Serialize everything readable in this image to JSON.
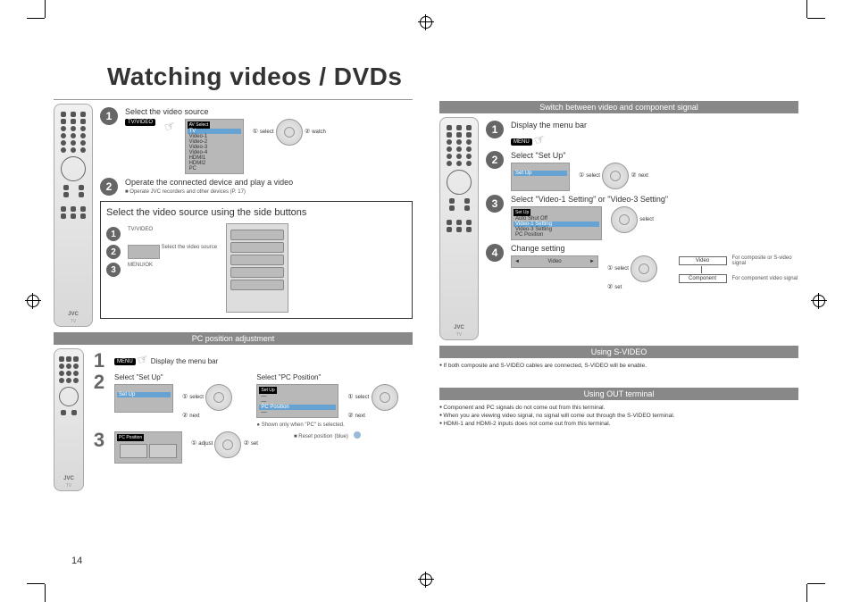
{
  "title": "Watching videos / DVDs",
  "page_number": "14",
  "remote": {
    "brand": "JVC",
    "model_label": "TV"
  },
  "left": {
    "step1": {
      "title": "Select the video source",
      "av_select_label": "AV Select",
      "sources": [
        "TV",
        "Video-1",
        "Video-2",
        "Video-3",
        "Video-4",
        "HDMI1",
        "HDMI2",
        "PC"
      ],
      "dial_top": "select",
      "dial_bottom": "watch",
      "key_label": "TV/VIDEO"
    },
    "step2": {
      "title": "Operate the connected device and play a video",
      "note": "Operate JVC recorders and other devices (P. 17)"
    },
    "boxed": {
      "title": "Select the video source using the side buttons",
      "s1": "TV/VIDEO",
      "s2": "Select the video source",
      "s3": "MENU/OK"
    },
    "pc_section": {
      "bar": "PC position adjustment",
      "s1_title": "Display the menu bar",
      "menu_key": "MENU",
      "s2_titleA": "Select \"Set Up\"",
      "s2_titleB": "Select \"PC Position\"",
      "menuA_header": "Set Up",
      "menuA_item": "Set Up",
      "menuB_header": "Set Up",
      "menuB_note": "Shown only when \"PC\" is selected.",
      "dial_sel": "select",
      "dial_next": "next",
      "s3_header": "PC Position",
      "s3_adjust": "adjust",
      "s3_set": "set",
      "reset_label": "Reset position",
      "blue_label": "(blue)"
    }
  },
  "right": {
    "switch_bar": "Switch between video and component signal",
    "s1_title": "Display the menu bar",
    "menu_key": "MENU",
    "s2_title": "Select \"Set Up\"",
    "menu2_item": "Set Up",
    "dial_sel": "select",
    "dial_next": "next",
    "s3_title": "Select \"Video-1 Setting\" or \"Video-3 Setting\"",
    "menu3_header": "Set Up",
    "menu3_rows": [
      "Auto Shut Off",
      "Video-1 Setting",
      "Video-3 Setting",
      "PC Position"
    ],
    "s3_dial": "select",
    "s4_title": "Change setting",
    "s4_row_label": "Video",
    "s4_dial_top": "select",
    "s4_dial_bottom": "set",
    "legend": {
      "video": "Video",
      "video_note": "For composite or S-video signal",
      "component": "Component",
      "component_note": "For component video signal"
    },
    "svideo_bar": "Using S-VIDEO",
    "svideo_note": "If both composite and S-VIDEO cables are connected, S-VIDEO will be enable.",
    "out_bar": "Using OUT terminal",
    "out_notes": [
      "Component and PC signals do not come out from this terminal.",
      "When you are viewing video signal, no signal will come out through the S-VIDEO terminal.",
      "HDMI-1 and HDMI-2 inputs does not come out from this terminal."
    ]
  }
}
